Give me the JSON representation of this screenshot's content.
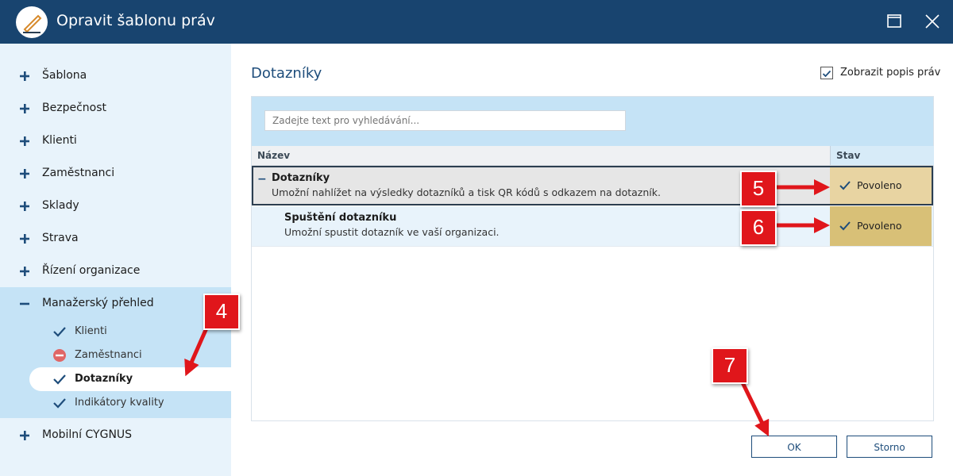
{
  "window": {
    "title": "Opravit šablonu práv"
  },
  "sidebar": {
    "items": [
      {
        "label": "Šablona"
      },
      {
        "label": "Bezpečnost"
      },
      {
        "label": "Klienti"
      },
      {
        "label": "Zaměstnanci"
      },
      {
        "label": "Sklady"
      },
      {
        "label": "Strava"
      },
      {
        "label": "Řízení organizace"
      },
      {
        "label": "Manažerský přehled"
      },
      {
        "label": "Mobilní CYGNUS"
      }
    ],
    "subitems": [
      {
        "label": "Klienti",
        "icon": "check-icon"
      },
      {
        "label": "Zaměstnanci",
        "icon": "no-entry-icon"
      },
      {
        "label": "Dotazníky",
        "icon": "check-icon"
      },
      {
        "label": "Indikátory kvality",
        "icon": "check-icon"
      }
    ]
  },
  "main": {
    "title": "Dotazníky",
    "show_desc_label": "Zobrazit popis práv",
    "search_placeholder": "Zadejte text pro vyhledávání...",
    "columns": {
      "name": "Název",
      "state": "Stav"
    },
    "rows": [
      {
        "title": "Dotazníky",
        "desc": "Umožní nahlížet na výsledky dotazníků a tisk QR kódů s odkazem na dotazník.",
        "state": "Povoleno",
        "toggle": "−"
      },
      {
        "title": "Spuštění dotazníku",
        "desc": "Umožní spustit dotazník ve vaší organizaci.",
        "state": "Povoleno"
      }
    ],
    "buttons": {
      "ok": "OK",
      "cancel": "Storno"
    }
  },
  "annotations": [
    "4",
    "5",
    "6",
    "7"
  ],
  "colors": {
    "titlebar": "#18446f",
    "accent": "#1e4d7b",
    "sidebar": "#e8f3fb",
    "allowed": "#e8d4a2",
    "badge": "#e0161b"
  }
}
